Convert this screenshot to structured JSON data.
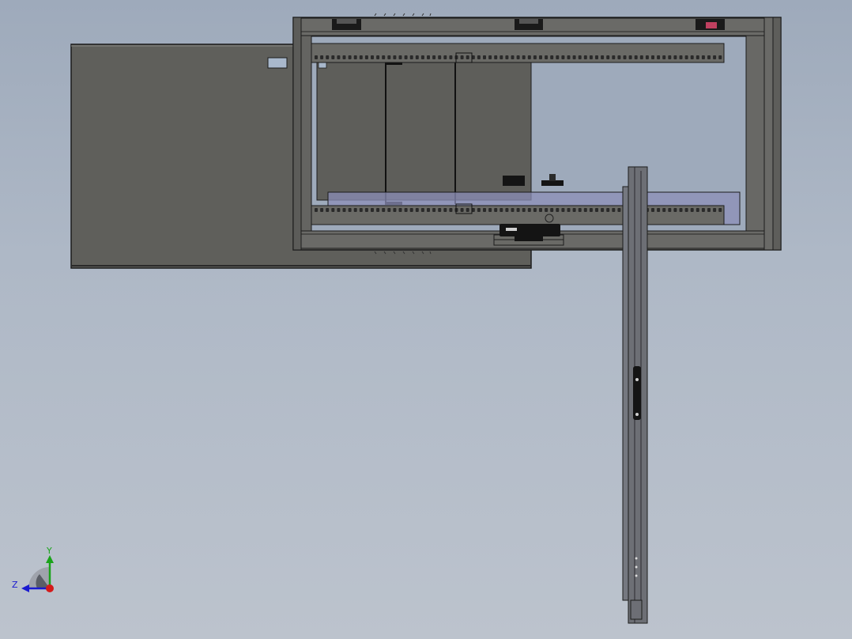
{
  "viewport": {
    "background_top": "#9eaabb",
    "background_bottom": "#bcc3cd"
  },
  "model": {
    "body_color": "#5e5e5a",
    "edge_color": "#1c1c1c",
    "panel_color": "#686864",
    "door_color": "#5f5f5b",
    "rail_color": "#6a6a66",
    "glass_color": "#8c8fb8",
    "latch_accent": "#c04060",
    "frame_color": "#6d6f75"
  },
  "triad": {
    "y_label": "Y",
    "z_label": "Z",
    "y_color": "#1aa31a",
    "z_color": "#1a1ad0",
    "x_color": "#d41a1a"
  }
}
